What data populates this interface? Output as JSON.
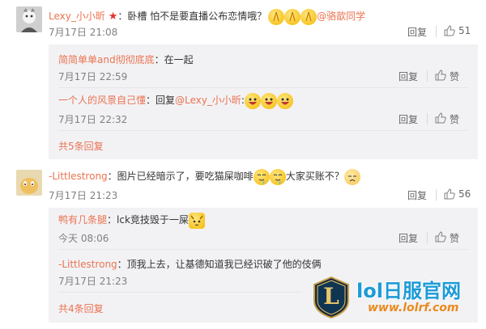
{
  "comments": [
    {
      "user": "Lexy_小小昕",
      "text_pre": "：卧槽 怕不是要直播公布恋情哦？",
      "mention": "@骆歆同学",
      "time": "7月17日 21:08",
      "reply": "回复",
      "likes": "51",
      "replies": [
        {
          "user": "简简单单and彻彻底底",
          "text": "：在一起",
          "time": "7月17日 22:59",
          "reply": "回复",
          "like": "赞"
        },
        {
          "user": "一个人的风景自己懂",
          "text_pre": "：回复",
          "mention": "@Lexy_小小昕",
          "text_post": ":",
          "time": "7月17日 22:32",
          "reply": "回复",
          "like": "赞"
        }
      ],
      "more": "共5条回复"
    },
    {
      "user": "-Littlestrong",
      "text_pre": "：图片已经暗示了，要吃猫屎咖啡",
      "text_mid": "大家买账不？",
      "time": "7月17日 21:23",
      "reply": "回复",
      "likes": "56",
      "replies": [
        {
          "user": "鸭有几条腿",
          "text": "：lck竞技毁于一屎",
          "time": "今天 08:06",
          "reply": "回复",
          "like": "赞"
        },
        {
          "user": "-Littlestrong",
          "text": "：顶我上去，让基德知道我已经识破了他的伎俩",
          "time": "7月17日 21:23",
          "reply": "回复",
          "like": "赞"
        }
      ],
      "more": "共4条回复"
    }
  ],
  "watermark": {
    "title": "lol日服官网",
    "url": "www.lolrf.com",
    "logo_letter": "L"
  },
  "icons": {
    "thumb": "thumbs-up-icon",
    "vip": "star-icon"
  },
  "colors": {
    "name": "#eb7350",
    "subbox": "#f2f2f5",
    "watermark_title": "#1c9bd6",
    "watermark_url": "#e98a1d"
  }
}
